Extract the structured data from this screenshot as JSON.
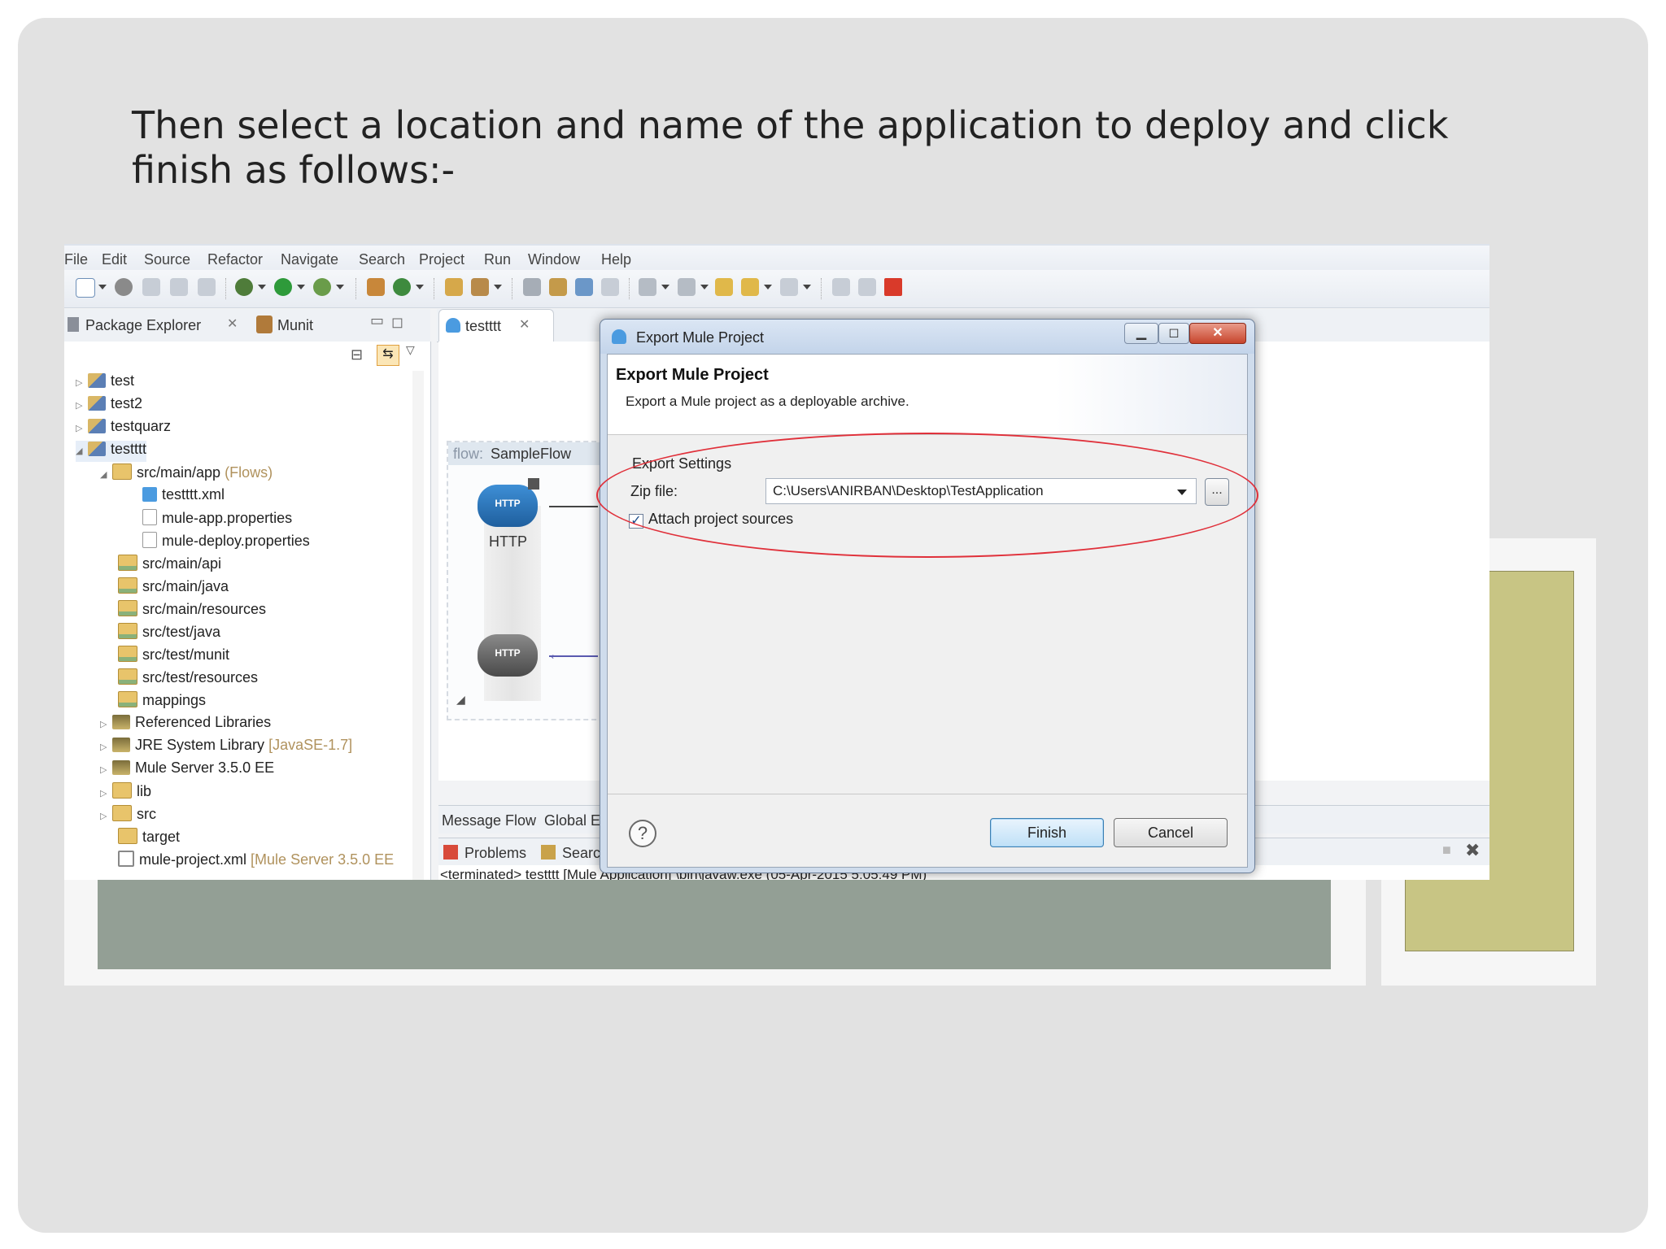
{
  "slide": {
    "heading": "Then select a location and name of the application to deploy and click finish as follows:-"
  },
  "menu": [
    "File",
    "Edit",
    "Source",
    "Refactor",
    "Navigate",
    "Search",
    "Project",
    "Run",
    "Window",
    "Help"
  ],
  "package_explorer": {
    "tab_label": "Package Explorer",
    "munit_tab_label": "Munit",
    "tree": [
      {
        "label": "test",
        "suffix": ""
      },
      {
        "label": "test2",
        "suffix": ""
      },
      {
        "label": "testquarz",
        "suffix": ""
      },
      {
        "label": "testttt",
        "suffix": ""
      },
      {
        "label": "src/main/app",
        "suffix": "(Flows)"
      },
      {
        "label": "testttt.xml",
        "suffix": ""
      },
      {
        "label": "mule-app.properties",
        "suffix": ""
      },
      {
        "label": "mule-deploy.properties",
        "suffix": ""
      },
      {
        "label": "src/main/api",
        "suffix": ""
      },
      {
        "label": "src/main/java",
        "suffix": ""
      },
      {
        "label": "src/main/resources",
        "suffix": ""
      },
      {
        "label": "src/test/java",
        "suffix": ""
      },
      {
        "label": "src/test/munit",
        "suffix": ""
      },
      {
        "label": "src/test/resources",
        "suffix": ""
      },
      {
        "label": "mappings",
        "suffix": ""
      },
      {
        "label": "Referenced Libraries",
        "suffix": ""
      },
      {
        "label": "JRE System Library",
        "suffix": "[JavaSE-1.7]"
      },
      {
        "label": "Mule Server 3.5.0 EE",
        "suffix": ""
      },
      {
        "label": "lib",
        "suffix": ""
      },
      {
        "label": "src",
        "suffix": ""
      },
      {
        "label": "target",
        "suffix": ""
      },
      {
        "label": "mule-project.xml",
        "suffix": "[Mule Server 3.5.0 EE"
      }
    ]
  },
  "editor": {
    "tab_label": "testttt",
    "flow_prefix": "flow:",
    "flow_name": "SampleFlow",
    "http_node_label": "HTTP",
    "http_badge": "HTTP",
    "bottom_tab_message_flow": "Message Flow",
    "bottom_tab_global": "Global E"
  },
  "console": {
    "problems_tab": "Problems",
    "search_tab": "Searc",
    "terminated_line": "<terminated> testttt [Mule Application] \\bin\\javaw.exe (05-Apr-2015 5:05:49 PM)"
  },
  "dialog": {
    "window_title": "Export Mule Project",
    "heading": "Export Mule Project",
    "description": "Export a Mule project as a deployable archive.",
    "group_label": "Export Settings",
    "zip_label": "Zip file:",
    "zip_value": "C:\\Users\\ANIRBAN\\Desktop\\TestApplication",
    "browse_label": "...",
    "attach_label": "Attach project sources",
    "attach_checked": true,
    "finish_label": "Finish",
    "cancel_label": "Cancel",
    "help_glyph": "?",
    "annotation_color": "#e0303a"
  },
  "colors": {
    "slide_bg": "#e2e2e2",
    "deco_gray": "#939f95",
    "deco_olive": "#c8c584"
  }
}
